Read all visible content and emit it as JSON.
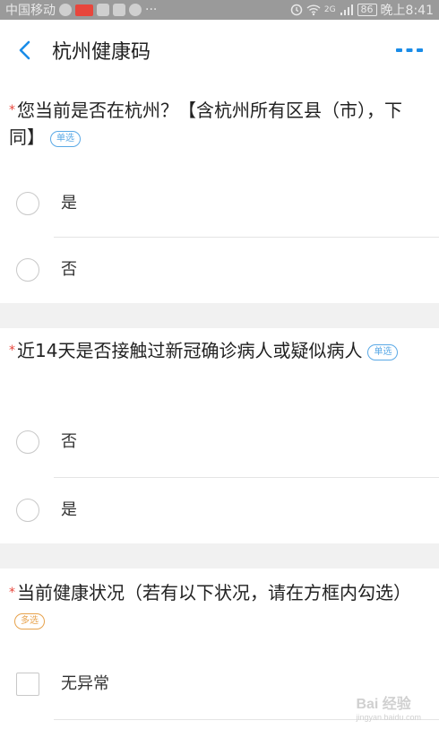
{
  "status_bar": {
    "carrier": "中国移动",
    "network": "2G",
    "battery": "86",
    "time": "晚上8:41"
  },
  "app_bar": {
    "title": "杭州健康码"
  },
  "questions": [
    {
      "required_mark": "*",
      "text": "您当前是否在杭州？【含杭州所有区县（市），下同】",
      "tag": "单选",
      "options": [
        "是",
        "否"
      ]
    },
    {
      "required_mark": "*",
      "text": "近14天是否接触过新冠确诊病人或疑似病人",
      "tag": "单选",
      "options": [
        "否",
        "是"
      ]
    },
    {
      "required_mark": "*",
      "text": "当前健康状况（若有以下状况，请在方框内勾选）",
      "tag": "多选",
      "options": [
        "无异常"
      ]
    }
  ],
  "watermark": {
    "text": "Bai 经验",
    "sub": "jingyan.baidu.com"
  },
  "colors": {
    "accent": "#1a8ce8",
    "required": "#e8463c",
    "single_tag": "#5aa9e6",
    "multi_tag": "#e7a24c",
    "gap": "#f1f1f1"
  }
}
